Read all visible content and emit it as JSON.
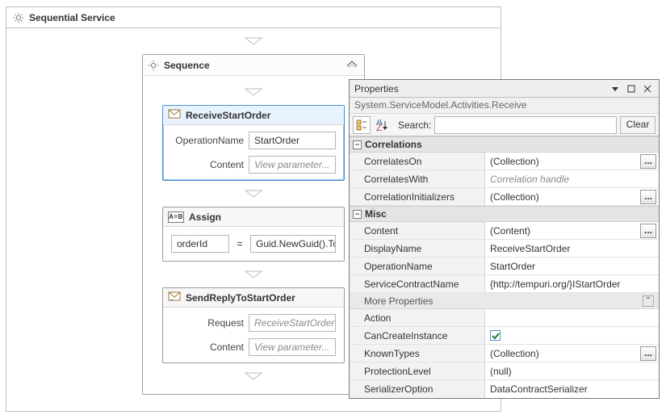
{
  "designer": {
    "rootTitle": "Sequential Service",
    "sequence": {
      "title": "Sequence",
      "receive": {
        "title": "ReceiveStartOrder",
        "opNameLabel": "OperationName",
        "opNameValue": "StartOrder",
        "contentLabel": "Content",
        "contentPlaceholder": "View parameter..."
      },
      "assign": {
        "title": "Assign",
        "left": "orderId",
        "eq": "=",
        "right": "Guid.NewGuid().To"
      },
      "reply": {
        "title": "SendReplyToStartOrder",
        "requestLabel": "Request",
        "requestValue": "ReceiveStartOrder",
        "contentLabel": "Content",
        "contentPlaceholder": "View parameter..."
      }
    }
  },
  "props": {
    "title": "Properties",
    "subtitle": "System.ServiceModel.Activities.Receive",
    "searchLabel": "Search:",
    "searchPlaceholder": "",
    "clearLabel": "Clear",
    "cat1": "Correlations",
    "cat2": "Misc",
    "moreProps": "More Properties",
    "ellipsis": "...",
    "rows": {
      "correlatesOn": {
        "name": "CorrelatesOn",
        "value": "(Collection)"
      },
      "correlatesWith": {
        "name": "CorrelatesWith",
        "value": "Correlation handle"
      },
      "correlationInit": {
        "name": "CorrelationInitializers",
        "value": "(Collection)"
      },
      "content": {
        "name": "Content",
        "value": "(Content)"
      },
      "displayName": {
        "name": "DisplayName",
        "value": "ReceiveStartOrder"
      },
      "operationName": {
        "name": "OperationName",
        "value": "StartOrder"
      },
      "serviceContractName": {
        "name": "ServiceContractName",
        "value": "{http://tempuri.org/}IStartOrder"
      },
      "action": {
        "name": "Action",
        "value": ""
      },
      "canCreateInstance": {
        "name": "CanCreateInstance",
        "checked": true
      },
      "knownTypes": {
        "name": "KnownTypes",
        "value": "(Collection)"
      },
      "protectionLevel": {
        "name": "ProtectionLevel",
        "value": "(null)"
      },
      "serializerOption": {
        "name": "SerializerOption",
        "value": "DataContractSerializer"
      }
    }
  }
}
